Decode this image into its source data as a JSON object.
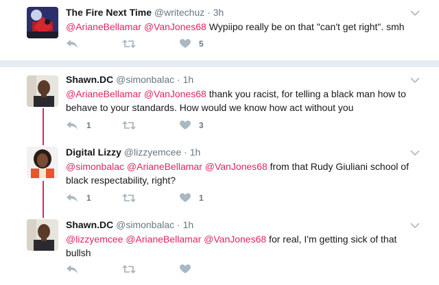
{
  "tweets": [
    {
      "name": "The Fire Next Time",
      "handle": "@writechuz",
      "time": "3h",
      "mentions": [
        "@ArianeBellamar",
        "@VanJones68"
      ],
      "text": " Wypiipo really be on that \"can't get right\". smh",
      "text2": "",
      "reply_count": "",
      "retweet_count": "",
      "like_count": "5"
    },
    {
      "name": "Shawn.DC",
      "handle": "@simonbalac",
      "time": "1h",
      "mentions": [
        "@ArianeBellamar",
        "@VanJones68"
      ],
      "text": " thank you racist, for telling a black man how to",
      "text2": "behave to your standards. How would we know how act without you",
      "reply_count": "1",
      "retweet_count": "",
      "like_count": "3"
    },
    {
      "name": "Digital Lizzy",
      "handle": "@lizzyemcee",
      "time": "1h",
      "mentions": [
        "@simonbalac",
        "@ArianeBellamar",
        "@VanJones68"
      ],
      "text": " from that Rudy Giuliani school of",
      "text2": "black respectability, right?",
      "reply_count": "1",
      "retweet_count": "",
      "like_count": "1"
    },
    {
      "name": "Shawn.DC",
      "handle": "@simonbalac",
      "time": "1h",
      "mentions": [
        "@lizzyemcee",
        "@ArianeBellamar",
        "@VanJones68"
      ],
      "text": " for real, I'm getting sick of that",
      "text2": "bullsh",
      "reply_count": "",
      "retweet_count": "",
      "like_count": ""
    }
  ],
  "colors": {
    "mention": "#e0245e",
    "muted": "#657786",
    "icon": "#aab8c2",
    "separator": "#e6ecf0"
  },
  "icons": [
    "reply-icon",
    "retweet-icon",
    "like-icon",
    "chevron-down-icon"
  ]
}
